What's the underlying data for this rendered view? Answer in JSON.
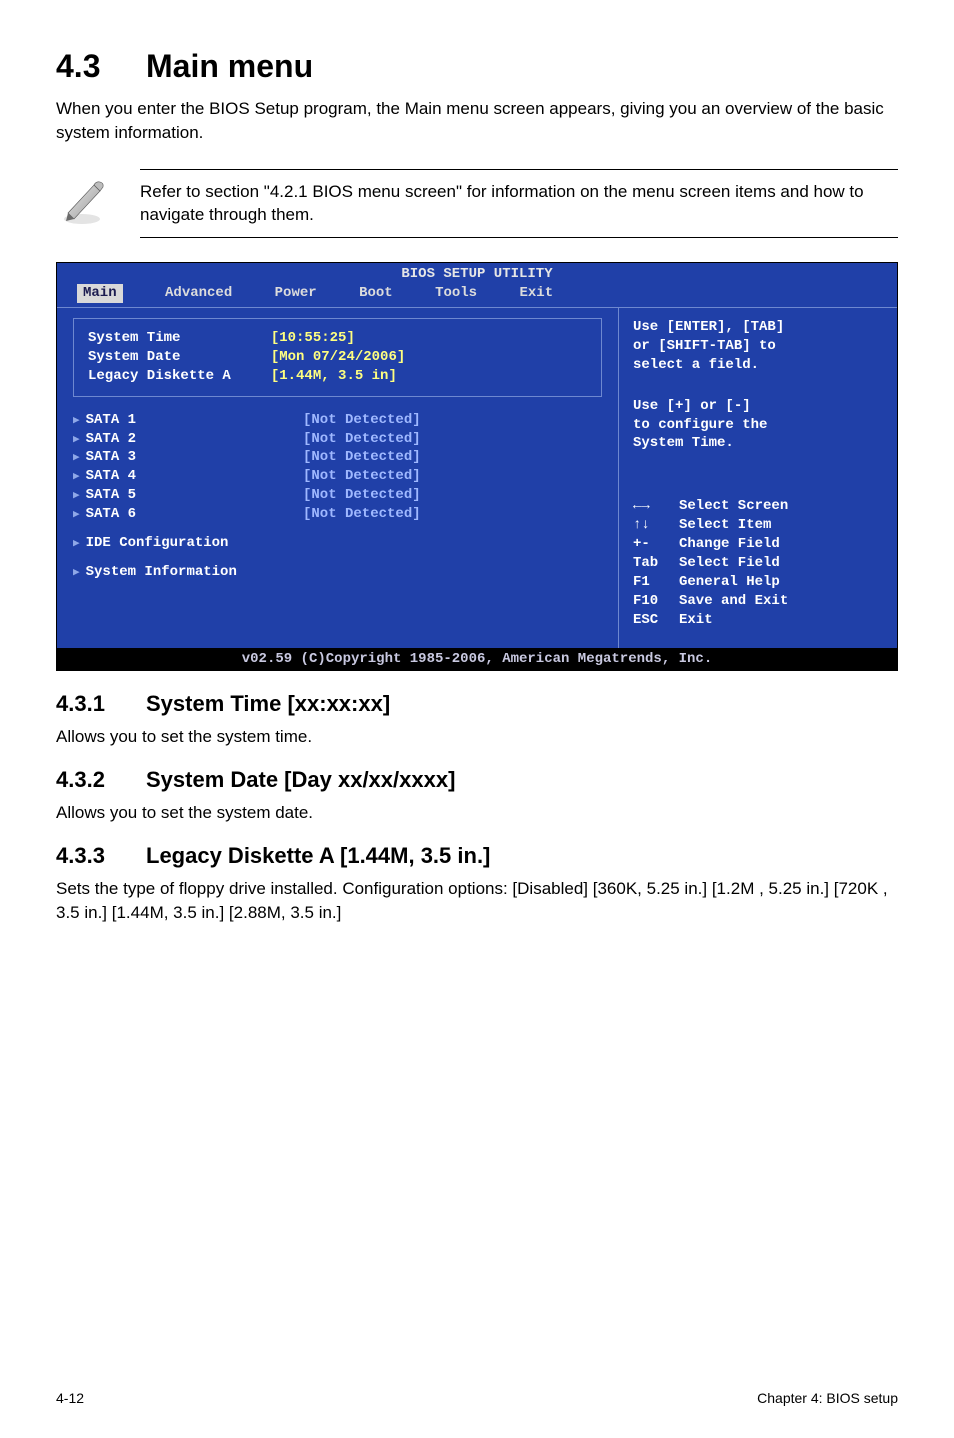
{
  "heading": {
    "num": "4.3",
    "title": "Main menu"
  },
  "intro": "When you enter the BIOS Setup program, the Main menu screen appears, giving you an overview of the basic system information.",
  "note": "Refer to section \"4.2.1  BIOS menu screen\" for information on the menu screen items and how to navigate through them.",
  "bios": {
    "title": "BIOS SETUP UTILITY",
    "menubar": [
      "Main",
      "Advanced",
      "Power",
      "Boot",
      "Tools",
      "Exit"
    ],
    "selected": "Main",
    "boxed_left": {
      "labels": [
        "System Time",
        "System Date",
        "Legacy Diskette A"
      ],
      "values": [
        "[10:55:25]",
        "[Mon 07/24/2006]",
        "[1.44M, 3.5 in]"
      ]
    },
    "sata_rows": [
      {
        "label": "SATA 1",
        "value": "[Not Detected]"
      },
      {
        "label": "SATA 2",
        "value": "[Not Detected]"
      },
      {
        "label": "SATA 3",
        "value": "[Not Detected]"
      },
      {
        "label": "SATA 4",
        "value": "[Not Detected]"
      },
      {
        "label": "SATA 5",
        "value": "[Not Detected]"
      },
      {
        "label": "SATA 6",
        "value": "[Not Detected]"
      }
    ],
    "extra_menus": [
      "IDE Configuration",
      "System Information"
    ],
    "right_top": [
      "Use [ENTER], [TAB]",
      "or [SHIFT-TAB] to",
      "select a field."
    ],
    "right_mid": [
      "Use [+] or [-]",
      "to configure the",
      "System Time."
    ],
    "right_help": [
      {
        "k": "←→",
        "t": "Select Screen"
      },
      {
        "k": "↑↓",
        "t": "Select Item"
      },
      {
        "k": "+-",
        "t": "Change Field"
      },
      {
        "k": "Tab",
        "t": "Select Field"
      },
      {
        "k": "F1",
        "t": "General Help"
      },
      {
        "k": "F10",
        "t": "Save and Exit"
      },
      {
        "k": "ESC",
        "t": "Exit"
      }
    ],
    "footer": "v02.59 (C)Copyright 1985-2006, American Megatrends, Inc."
  },
  "subs": [
    {
      "num": "4.3.1",
      "title": "System Time [xx:xx:xx]",
      "body": "Allows you to set the system time."
    },
    {
      "num": "4.3.2",
      "title": "System Date [Day xx/xx/xxxx]",
      "body": "Allows you to set the system date."
    },
    {
      "num": "4.3.3",
      "title": "Legacy Diskette A [1.44M, 3.5 in.]",
      "body": "Sets the type of floppy drive installed. Configuration options: [Disabled] [360K, 5.25 in.] [1.2M , 5.25 in.] [720K , 3.5 in.] [1.44M, 3.5 in.] [2.88M, 3.5 in.]"
    }
  ],
  "page_footer": {
    "left": "4-12",
    "right": "Chapter 4: BIOS setup"
  }
}
